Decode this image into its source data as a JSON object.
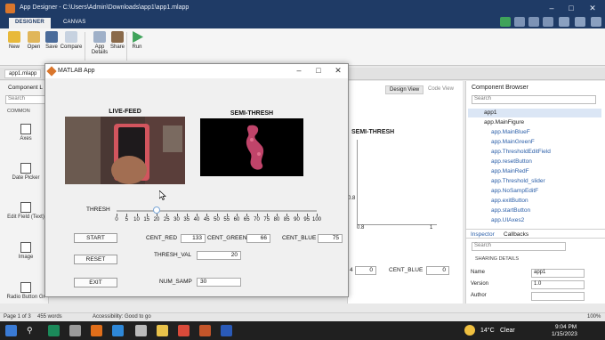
{
  "designer": {
    "title": "App Designer - C:\\Users\\Admin\\Downloads\\app1\\app1.mlapp",
    "tabs": [
      "DESIGNER",
      "CANVAS"
    ],
    "toolstrip": {
      "new": "New",
      "open": "Open",
      "save": "Save",
      "compare": "Compare",
      "app_details_1": "App",
      "app_details_2": "Details",
      "share": "Share",
      "run": "Run"
    },
    "file_tab": "app1.mlapp",
    "left_panel": {
      "title": "Component L",
      "search_placeholder": "Search",
      "section": "COMMON",
      "components": [
        "Axes",
        "Date Picker",
        "Edit Field (Text)",
        "Image",
        "Radio Button Gr"
      ]
    },
    "view_tabs": [
      "Design View",
      "Code View"
    ],
    "canvas_labels": {
      "semi_thresh": "SEMI-THRESH",
      "scale_4": "4",
      "cent_blue": "CENT_BLUE",
      "field0a": "0",
      "field0b": "0",
      "axis_1": "1",
      "axis_08": "0.8"
    },
    "browser": {
      "title": "Component Browser",
      "search_placeholder": "Search",
      "items": [
        "app1",
        "app.MainFigure",
        "app.MainBlueF",
        "app.MainGreenF",
        "app.ThresholdEditField",
        "app.resetButton",
        "app.MainRedF",
        "app.Threshold_slider",
        "app.NoSampEditF",
        "app.exitButton",
        "app.startButton",
        "app.UIAxes2"
      ]
    },
    "inspector": {
      "tabs": [
        "Inspector",
        "Callbacks"
      ],
      "search_placeholder": "Search",
      "section": "SHARING DETAILS",
      "rows": [
        {
          "label": "Name",
          "value": "app1"
        },
        {
          "label": "Version",
          "value": "1.0"
        },
        {
          "label": "Author",
          "value": ""
        }
      ]
    },
    "status": {
      "page": "Page 1 of 3",
      "words": "455 words",
      "accessibility": "Accessibility: Good to go",
      "zoom": "100%"
    }
  },
  "taskbar": {
    "weather": "14°C",
    "weather_desc": "Clear",
    "time": "9:04 PM",
    "date": "1/15/2023"
  },
  "app": {
    "title": "MATLAB App",
    "live_feed_title": "LIVE-FEED",
    "semi_thresh_title": "SEMI-THRESH",
    "slider": {
      "label": "THRESH",
      "value": 20,
      "min": 0,
      "max": 100,
      "ticks": [
        "0",
        "5",
        "10",
        "15",
        "20",
        "25",
        "30",
        "35",
        "40",
        "45",
        "50",
        "55",
        "60",
        "65",
        "70",
        "75",
        "80",
        "85",
        "90",
        "95",
        "100"
      ]
    },
    "buttons": {
      "start": "START",
      "reset": "RESET",
      "exit": "EXIT"
    },
    "fields": {
      "cent_red_label": "CENT_RED",
      "cent_red": "133",
      "cent_green_label": "CENT_GREEN",
      "cent_green": "66",
      "cent_blue_label": "CENT_BLUE",
      "cent_blue": "75",
      "thresh_val_label": "THRESH_VAL",
      "thresh_val": "20",
      "num_samp_label": "NUM_SAMP",
      "num_samp": "30"
    },
    "colors": {
      "accent": "#1f3b66",
      "blob": "#c0446a",
      "feed_bg": "#3a2a26"
    }
  }
}
